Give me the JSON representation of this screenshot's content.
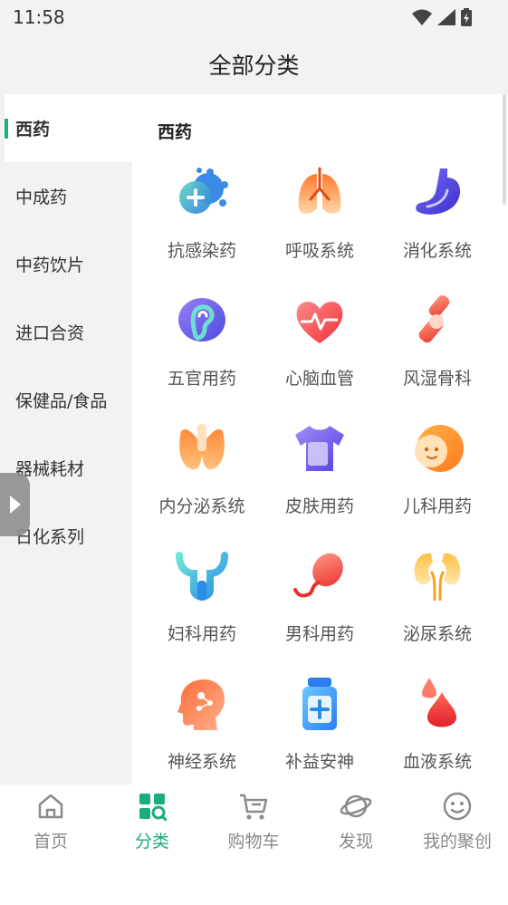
{
  "status": {
    "time": "11:58"
  },
  "header": {
    "title": "全部分类"
  },
  "sidebar": {
    "items": [
      {
        "label": "西药",
        "active": true
      },
      {
        "label": "中成药"
      },
      {
        "label": "中药饮片"
      },
      {
        "label": "进口合资"
      },
      {
        "label": "保健品/食品"
      },
      {
        "label": "器械耗材"
      },
      {
        "label": "日化系列"
      }
    ]
  },
  "panel": {
    "title": "西药",
    "categories": [
      {
        "label": "抗感染药",
        "icon": "virus-icon"
      },
      {
        "label": "呼吸系统",
        "icon": "lungs-icon"
      },
      {
        "label": "消化系统",
        "icon": "stomach-icon"
      },
      {
        "label": "五官用药",
        "icon": "ear-icon"
      },
      {
        "label": "心脑血管",
        "icon": "heart-pulse-icon"
      },
      {
        "label": "风湿骨科",
        "icon": "bone-icon"
      },
      {
        "label": "内分泌系统",
        "icon": "thyroid-icon"
      },
      {
        "label": "皮肤用药",
        "icon": "shirt-icon"
      },
      {
        "label": "儿科用药",
        "icon": "baby-face-icon"
      },
      {
        "label": "妇科用药",
        "icon": "uterus-icon"
      },
      {
        "label": "男科用药",
        "icon": "sperm-icon"
      },
      {
        "label": "泌尿系统",
        "icon": "kidney-icon"
      },
      {
        "label": "神经系统",
        "icon": "brain-head-icon"
      },
      {
        "label": "补益安神",
        "icon": "medicine-bottle-icon"
      },
      {
        "label": "血液系统",
        "icon": "blood-drop-icon"
      }
    ]
  },
  "tabbar": {
    "items": [
      {
        "label": "首页",
        "icon": "home-icon"
      },
      {
        "label": "分类",
        "icon": "category-icon",
        "active": true
      },
      {
        "label": "购物车",
        "icon": "cart-icon"
      },
      {
        "label": "发现",
        "icon": "planet-icon"
      },
      {
        "label": "我的聚创",
        "icon": "smiley-icon"
      }
    ]
  },
  "colors": {
    "accent": "#1aab7e",
    "sidebar_bg": "#f2f2f2",
    "text": "#333333",
    "tab_inactive": "#8a8a8a"
  }
}
